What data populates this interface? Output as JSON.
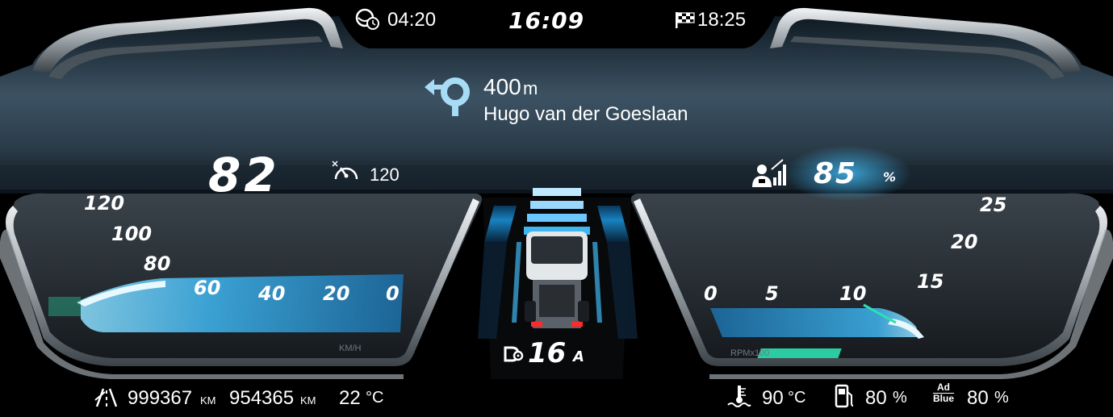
{
  "top_bar": {
    "drive_time": "04:20",
    "clock": "16:09",
    "eta": "18:25"
  },
  "navigation": {
    "distance_value": "400",
    "distance_unit": "m",
    "street": "Hugo van der Goeslaan"
  },
  "speed": {
    "current": "82",
    "limit": "120",
    "scale_labels": [
      "120",
      "100",
      "80",
      "60",
      "40",
      "20",
      "0"
    ],
    "unit": "KM/H",
    "level_fraction": 0.68
  },
  "engine": {
    "load_value": "85",
    "load_unit": "%",
    "scale_labels": [
      "0",
      "5",
      "10",
      "15",
      "20",
      "25"
    ],
    "unit": "RPMx100",
    "level_fraction": 0.46
  },
  "gear": {
    "value": "16",
    "mode": "A"
  },
  "bottom_bar": {
    "odometer": "999367",
    "odometer_unit": "KM",
    "trip": "954365",
    "trip_unit": "KM",
    "outside_temp": "22",
    "outside_temp_unit": "°C",
    "coolant_temp": "90",
    "coolant_temp_unit": "°C",
    "fuel_level": "80",
    "fuel_unit": "%",
    "adblue_label_top": "Ad",
    "adblue_label_bottom": "Blue",
    "adblue_level": "80",
    "adblue_unit": "%"
  },
  "colors": {
    "accent_blue": "#3fb6f0",
    "accent_green": "#2ee0b0",
    "text": "#ffffff"
  },
  "icons": [
    "driving-time-icon",
    "destination-flag-icon",
    "roundabout-left-icon",
    "speed-limiter-icon",
    "engine-load-icon",
    "gear-cog-icon",
    "odometer-road-icon",
    "coolant-temp-icon",
    "fuel-pump-icon",
    "adblue-icon",
    "truck-icon"
  ]
}
